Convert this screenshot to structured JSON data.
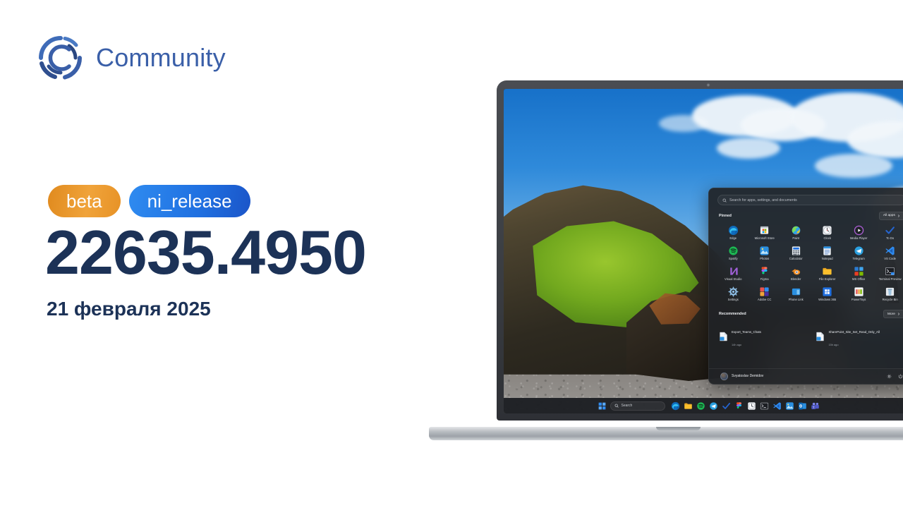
{
  "brand": {
    "name": "Community",
    "logo_icon": "community-c-logo",
    "color": "#3a5fa8"
  },
  "release": {
    "badges": [
      {
        "label": "beta",
        "color": "#e79226"
      },
      {
        "label": "ni_release",
        "color": "#1f6fe0"
      }
    ],
    "build_number": "22635.4950",
    "date": "21 февраля 2025",
    "text_color": "#1c3257"
  },
  "laptop": {
    "wallpaper_description": "Iceland mossy cliff and black pebble beach under blue sky"
  },
  "start_menu": {
    "search": {
      "placeholder": "Search for apps, settings, and documents",
      "icon": "search-icon"
    },
    "pinned": {
      "title": "Pinned",
      "all_apps_label": "All apps",
      "all_apps_icon": "chevron-right-icon",
      "apps": [
        {
          "label": "Edge",
          "icon": "edge-icon"
        },
        {
          "label": "Microsoft Store",
          "icon": "microsoft-store-icon"
        },
        {
          "label": "Paint",
          "icon": "paint-icon"
        },
        {
          "label": "Clock",
          "icon": "clock-icon"
        },
        {
          "label": "Media Player",
          "icon": "media-player-icon"
        },
        {
          "label": "To Do",
          "icon": "to-do-icon"
        },
        {
          "label": "Spotify",
          "icon": "spotify-icon"
        },
        {
          "label": "Photos",
          "icon": "photos-icon"
        },
        {
          "label": "Calculator",
          "icon": "calculator-icon"
        },
        {
          "label": "Notepad",
          "icon": "notepad-icon"
        },
        {
          "label": "Telegram",
          "icon": "telegram-icon"
        },
        {
          "label": "VS Code",
          "icon": "vs-code-icon"
        },
        {
          "label": "Visual Studio",
          "icon": "visual-studio-icon"
        },
        {
          "label": "Figma",
          "icon": "figma-icon"
        },
        {
          "label": "Blender",
          "icon": "blender-icon"
        },
        {
          "label": "File Explorer",
          "icon": "file-explorer-icon"
        },
        {
          "label": "MS Office",
          "icon": "ms-office-icon"
        },
        {
          "label": "Terminal Preview",
          "icon": "terminal-preview-icon"
        },
        {
          "label": "Settings",
          "icon": "settings-gear-icon"
        },
        {
          "label": "Adobe CC",
          "icon": "adobe-cc-icon"
        },
        {
          "label": "Phone Link",
          "icon": "phone-link-icon"
        },
        {
          "label": "Windows 365",
          "icon": "windows-365-icon"
        },
        {
          "label": "PowerToys",
          "icon": "powertoys-icon"
        },
        {
          "label": "Recycle Bin",
          "icon": "recycle-bin-icon"
        }
      ]
    },
    "recommended": {
      "title": "Recommended",
      "more_label": "More",
      "more_icon": "chevron-right-icon",
      "items": [
        {
          "name": "Export_Teams_Chats",
          "time": "14h ago",
          "icon": "document-file-icon"
        },
        {
          "name": "SharePoint_Site_Set_Read_Only_All",
          "time": "15h ago",
          "icon": "document-file-icon"
        }
      ]
    },
    "footer": {
      "user_name": "Svyatoslav Demidov",
      "avatar_icon": "user-avatar",
      "settings_icon": "settings-gear-icon",
      "power_icon": "power-icon"
    }
  },
  "taskbar": {
    "start_icon": "windows-start-icon",
    "search": {
      "placeholder": "Search",
      "icon": "search-icon"
    },
    "apps": [
      {
        "label": "Edge",
        "icon": "edge-icon"
      },
      {
        "label": "File Explorer",
        "icon": "file-explorer-icon"
      },
      {
        "label": "Spotify",
        "icon": "spotify-icon"
      },
      {
        "label": "Telegram",
        "icon": "telegram-icon"
      },
      {
        "label": "To Do",
        "icon": "to-do-icon"
      },
      {
        "label": "Figma",
        "icon": "figma-icon"
      },
      {
        "label": "Clock",
        "icon": "clock-icon"
      },
      {
        "label": "Terminal",
        "icon": "terminal-preview-icon"
      },
      {
        "label": "VS Code",
        "icon": "vs-code-icon"
      },
      {
        "label": "Photos",
        "icon": "photos-icon"
      },
      {
        "label": "Outlook",
        "icon": "outlook-icon"
      },
      {
        "label": "Teams",
        "icon": "teams-icon"
      }
    ]
  }
}
